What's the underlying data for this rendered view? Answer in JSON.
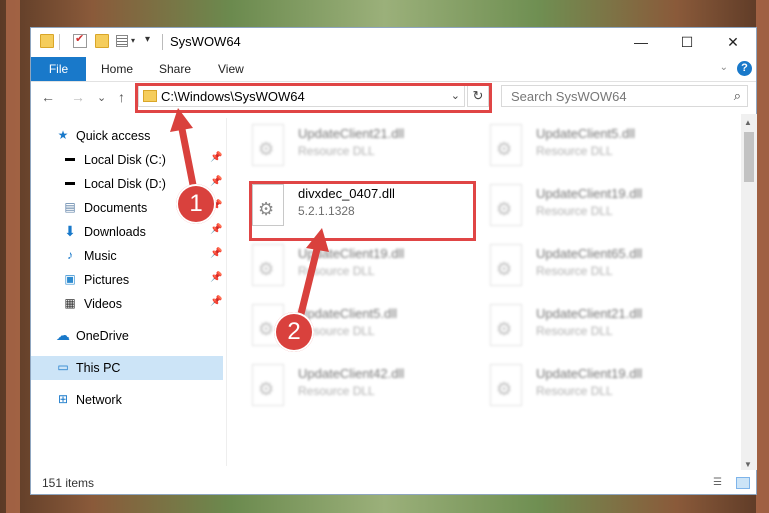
{
  "window": {
    "title": "SysWOW64",
    "controls": {
      "minimize": "—",
      "maximize": "☐",
      "close": "✕"
    }
  },
  "ribbon": {
    "file_tab": "File",
    "tabs": [
      "Home",
      "Share",
      "View"
    ],
    "help": "?"
  },
  "navigation": {
    "back": "←",
    "forward": "→",
    "recent": "⌄",
    "up": "↑",
    "address": "C:\\Windows\\SysWOW64",
    "refresh": "↻",
    "search_placeholder": "Search SysWOW64"
  },
  "sidebar": {
    "items": [
      {
        "label": "Quick access",
        "icon": "star-icon"
      },
      {
        "label": "Local Disk (C:)",
        "icon": "drive-icon",
        "pinned": true
      },
      {
        "label": "Local Disk (D:)",
        "icon": "drive-icon",
        "pinned": true
      },
      {
        "label": "Documents",
        "icon": "document-icon",
        "pinned": true
      },
      {
        "label": "Downloads",
        "icon": "download-icon",
        "pinned": true
      },
      {
        "label": "Music",
        "icon": "music-icon",
        "pinned": true
      },
      {
        "label": "Pictures",
        "icon": "pictures-icon",
        "pinned": true
      },
      {
        "label": "Videos",
        "icon": "video-icon",
        "pinned": true
      },
      {
        "label": "OneDrive",
        "icon": "cloud-icon"
      },
      {
        "label": "This PC",
        "icon": "computer-icon",
        "selected": true
      },
      {
        "label": "Network",
        "icon": "network-icon"
      }
    ]
  },
  "files": {
    "left_column": [
      {
        "name": "UpdateClient21.dll",
        "sub": "Resource DLL",
        "blurred": true
      },
      {
        "name": "divxdec_0407.dll",
        "sub": "5.2.1.1328",
        "blurred": false
      },
      {
        "name": "UpdateClient19.dll",
        "sub": "Resource DLL",
        "blurred": true
      },
      {
        "name": "UpdateClient5.dll",
        "sub": "Resource DLL",
        "blurred": true
      },
      {
        "name": "UpdateClient42.dll",
        "sub": "Resource DLL",
        "blurred": true
      }
    ],
    "right_column": [
      {
        "name": "UpdateClient5.dll",
        "sub": "Resource DLL",
        "blurred": true
      },
      {
        "name": "UpdateClient19.dll",
        "sub": "Resource DLL",
        "blurred": true
      },
      {
        "name": "UpdateClient65.dll",
        "sub": "Resource DLL",
        "blurred": true
      },
      {
        "name": "UpdateClient21.dll",
        "sub": "Resource DLL",
        "blurred": true
      },
      {
        "name": "UpdateClient19.dll",
        "sub": "Resource DLL",
        "blurred": true
      }
    ]
  },
  "status": {
    "item_count": "151 items"
  },
  "annotations": {
    "step1": "1",
    "step2": "2",
    "color": "#d9413d"
  }
}
